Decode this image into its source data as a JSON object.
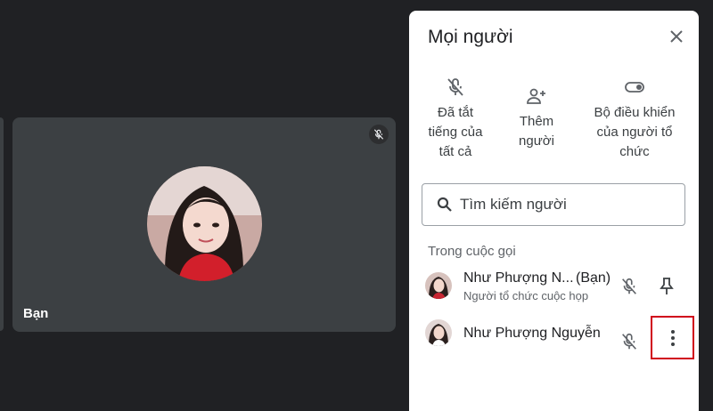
{
  "video_tile": {
    "name": "Bạn",
    "mic_icon": "mic-off-icon",
    "avatar": "user-photo"
  },
  "panel": {
    "title": "Mọi người",
    "close_icon": "close-icon",
    "actions": [
      {
        "lines": [
          "Đã tắt",
          "tiếng của",
          "tất cả"
        ],
        "icon": "mic-off-icon"
      },
      {
        "lines": [
          "Thêm",
          "người"
        ],
        "icon": "add-person-icon"
      },
      {
        "lines": [
          "Bộ điều khiển",
          "của người tổ",
          "chức"
        ],
        "icon": "toggle-icon"
      }
    ],
    "search": {
      "placeholder": "Tìm kiếm người",
      "value": ""
    },
    "section_title": "Trong cuộc gọi",
    "participants": [
      {
        "name": "Như Phượng N...",
        "tag": "(Bạn)",
        "role": "Người tổ chức cuộc họp",
        "mic": "mic-off-icon",
        "action": "pin-icon"
      },
      {
        "name": "Như Phượng Nguyễn",
        "mic": "mic-off-icon",
        "action": "more-vert-icon"
      }
    ]
  },
  "colors": {
    "background": "#202124",
    "tile": "#3c4043",
    "panel": "#ffffff",
    "highlight": "#d0021b"
  }
}
